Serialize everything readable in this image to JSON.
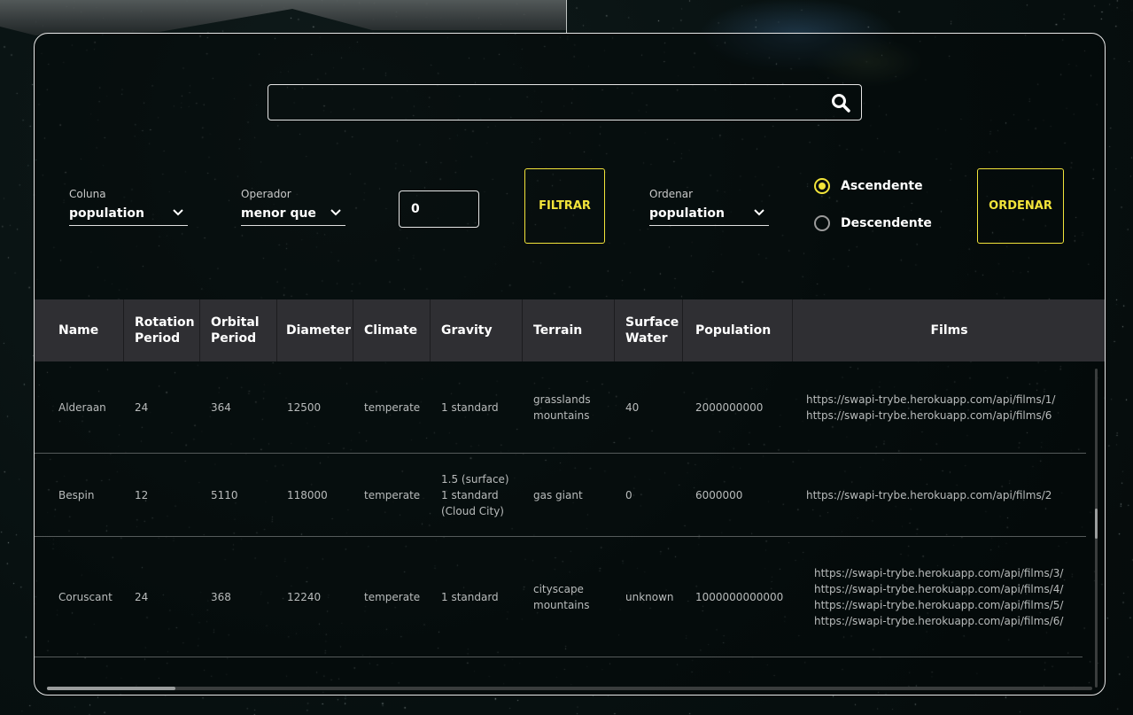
{
  "search": {
    "value": "",
    "placeholder": ""
  },
  "filter": {
    "column_label": "Coluna",
    "column_value": "population",
    "operator_label": "Operador",
    "operator_value": "menor que",
    "number_value": "0",
    "button_label": "FILTRAR"
  },
  "sort": {
    "label": "Ordenar",
    "value": "population",
    "asc_label": "Ascendente",
    "desc_label": "Descendente",
    "selected": "asc",
    "button_label": "ORDENAR"
  },
  "table": {
    "headers": {
      "name": "Name",
      "rotation": "Rotation\nPeriod",
      "orbital": "Orbital\nPeriod",
      "diameter": "Diameter",
      "climate": "Climate",
      "gravity": "Gravity",
      "terrain": "Terrain",
      "surface": "Surface\nWater",
      "population": "Population",
      "films": "Films"
    },
    "rows": [
      {
        "name": "Alderaan",
        "rotation": "24",
        "orbital": "364",
        "diameter": "12500",
        "climate": "temperate",
        "gravity": "1 standard",
        "terrain": "grasslands\nmountains",
        "surface": "40",
        "population": "2000000000",
        "films": "https://swapi-trybe.herokuapp.com/api/films/1/\nhttps://swapi-trybe.herokuapp.com/api/films/6"
      },
      {
        "name": "Bespin",
        "rotation": "12",
        "orbital": "5110",
        "diameter": "118000",
        "climate": "temperate",
        "gravity": "1.5 (surface)\n1 standard\n(Cloud City)",
        "terrain": "gas giant",
        "surface": "0",
        "population": "6000000",
        "films": "https://swapi-trybe.herokuapp.com/api/films/2"
      },
      {
        "name": "Coruscant",
        "rotation": "24",
        "orbital": "368",
        "diameter": "12240",
        "climate": "temperate",
        "gravity": "1 standard",
        "terrain": "cityscape\nmountains",
        "surface": "unknown",
        "population": "1000000000000",
        "films": "https://swapi-trybe.herokuapp.com/api/films/3/\nhttps://swapi-trybe.herokuapp.com/api/films/4/\nhttps://swapi-trybe.herokuapp.com/api/films/5/\nhttps://swapi-trybe.herokuapp.com/api/films/6/"
      }
    ]
  },
  "colors": {
    "accent": "#f2e43a",
    "header_bg": "#2f2f33",
    "border": "#e6e6e6"
  },
  "icons": {
    "search": "search-icon",
    "dropdown": "chevron-down-icon"
  }
}
